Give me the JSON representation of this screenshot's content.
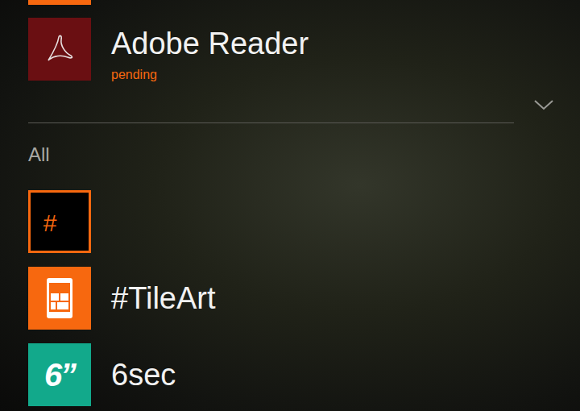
{
  "scrolled_tile": {
    "color": "#f7680f"
  },
  "pending_apps": [
    {
      "name": "Adobe Reader",
      "status": "pending",
      "color": "#6a0f12"
    }
  ],
  "section": {
    "label": "All"
  },
  "apps": [
    {
      "kind": "letter",
      "name": "#",
      "color": "#f7680f"
    },
    {
      "kind": "tileart",
      "name": "#TileArt",
      "color": "#f7680f"
    },
    {
      "kind": "sixsec",
      "name": "6sec",
      "logo_text": "6”",
      "color": "#12a98b"
    }
  ]
}
